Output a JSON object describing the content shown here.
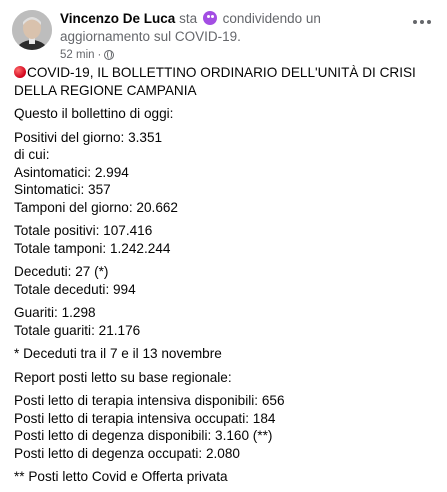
{
  "header": {
    "author": "Vincenzo De Luca",
    "activity_prefix": "sta",
    "activity_icon": "smile-activity-icon",
    "activity_text": "condividendo un aggiornamento sul COVID-19.",
    "timestamp": "52 min",
    "separator": "·",
    "privacy_icon": "globe-icon"
  },
  "post": {
    "title": "COVID-19, IL BOLLETTINO ORDINARIO DELL'UNITÀ DI CRISI DELLA REGIONE CAMPANIA",
    "intro": "Questo il bollettino di oggi:",
    "block1": [
      "Positivi del giorno: 3.351",
      "di cui:",
      "Asintomatici: 2.994",
      "Sintomatici: 357",
      "Tamponi del giorno: 20.662"
    ],
    "block2": [
      "Totale positivi: 107.416",
      "Totale tamponi: 1.242.244"
    ],
    "block3": [
      "Deceduti: 27 (*)",
      "Totale deceduti: 994"
    ],
    "block4": [
      "Guariti: 1.298",
      "Totale guariti: 21.176"
    ],
    "note1": "* Deceduti tra il 7 e il 13 novembre",
    "report_intro": "Report posti letto su base regionale:",
    "block5": [
      "Posti letto di terapia intensiva disponibili: 656",
      "Posti letto di terapia intensiva occupati: 184",
      "Posti letto di degenza disponibili: 3.160 (**)",
      "Posti letto di degenza occupati: 2.080"
    ],
    "note2": "** Posti letto Covid e Offerta privata"
  }
}
